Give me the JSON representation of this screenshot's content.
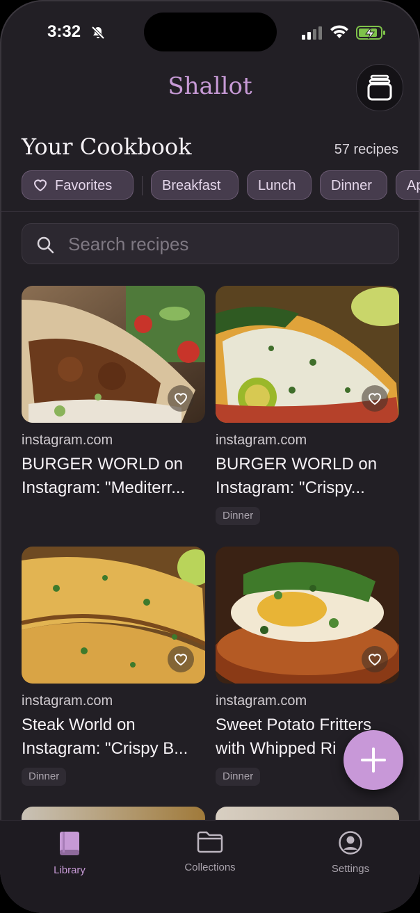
{
  "status_bar": {
    "time": "3:32"
  },
  "header": {
    "app_title": "Shallot",
    "stack_icon": "stack-icon"
  },
  "cookbook": {
    "title": "Your Cookbook",
    "count": "57 recipes"
  },
  "filters": [
    {
      "label": "Favorites",
      "icon": "heart-icon"
    },
    {
      "label": "Breakfast"
    },
    {
      "label": "Lunch"
    },
    {
      "label": "Dinner"
    },
    {
      "label": "Ap"
    }
  ],
  "search": {
    "placeholder": "Search recipes",
    "value": ""
  },
  "recipes": [
    {
      "source": "instagram.com",
      "title": "BURGER WORLD on",
      "title2": "Instagram: \"Mediterr...",
      "tag": ""
    },
    {
      "source": "instagram.com",
      "title": "BURGER WORLD on",
      "title2": "Instagram: \"Crispy...",
      "tag": "Dinner"
    },
    {
      "source": "instagram.com",
      "title": "Steak World on",
      "title2": "Instagram: \"Crispy B...",
      "tag": "Dinner"
    },
    {
      "source": "instagram.com",
      "title": "Sweet Potato Fritters",
      "title2": "with Whipped Ri",
      "tag": "Dinner"
    }
  ],
  "tabs": [
    {
      "label": "Library",
      "icon": "book-icon",
      "active": true
    },
    {
      "label": "Collections",
      "icon": "folder-icon",
      "active": false
    },
    {
      "label": "Settings",
      "icon": "profile-icon",
      "active": false
    }
  ],
  "colors": {
    "accent": "#c79ad6",
    "background": "#221f25",
    "chip": "#463c4d"
  }
}
